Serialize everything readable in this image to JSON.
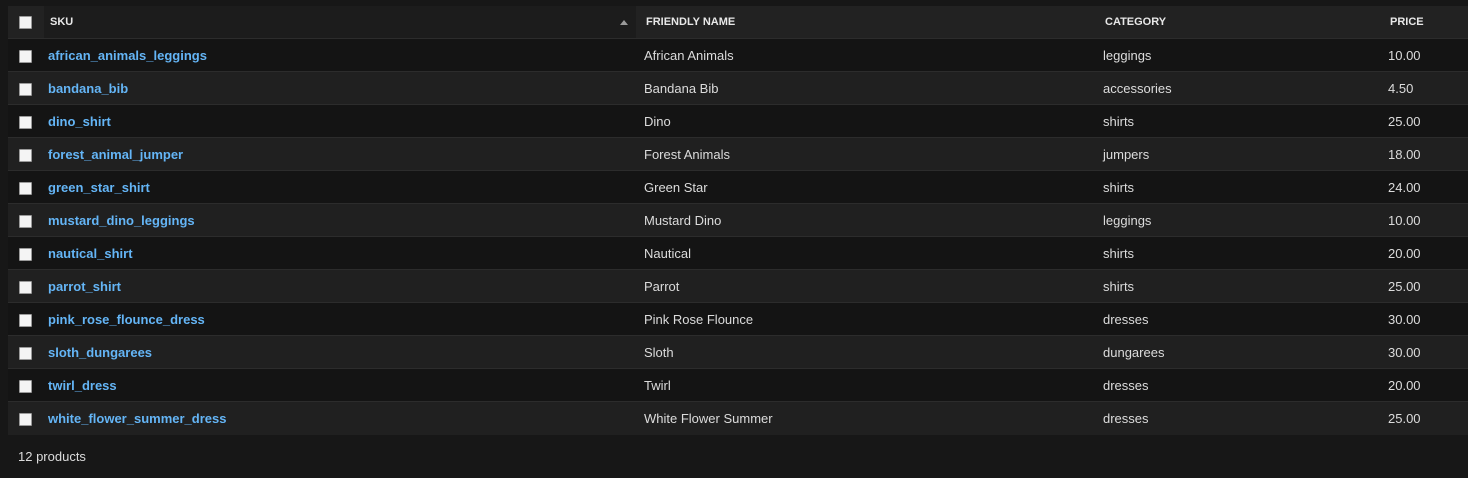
{
  "table": {
    "headers": {
      "sku": "SKU",
      "friendly_name": "FRIENDLY NAME",
      "category": "CATEGORY",
      "price": "PRICE"
    },
    "rows": [
      {
        "sku": "african_animals_leggings",
        "name": "African Animals",
        "category": "leggings",
        "price": "10.00"
      },
      {
        "sku": "bandana_bib",
        "name": "Bandana Bib",
        "category": "accessories",
        "price": "4.50"
      },
      {
        "sku": "dino_shirt",
        "name": "Dino",
        "category": "shirts",
        "price": "25.00"
      },
      {
        "sku": "forest_animal_jumper",
        "name": "Forest Animals",
        "category": "jumpers",
        "price": "18.00"
      },
      {
        "sku": "green_star_shirt",
        "name": "Green Star",
        "category": "shirts",
        "price": "24.00"
      },
      {
        "sku": "mustard_dino_leggings",
        "name": "Mustard Dino",
        "category": "leggings",
        "price": "10.00"
      },
      {
        "sku": "nautical_shirt",
        "name": "Nautical",
        "category": "shirts",
        "price": "20.00"
      },
      {
        "sku": "parrot_shirt",
        "name": "Parrot",
        "category": "shirts",
        "price": "25.00"
      },
      {
        "sku": "pink_rose_flounce_dress",
        "name": "Pink Rose Flounce",
        "category": "dresses",
        "price": "30.00"
      },
      {
        "sku": "sloth_dungarees",
        "name": "Sloth",
        "category": "dungarees",
        "price": "30.00"
      },
      {
        "sku": "twirl_dress",
        "name": "Twirl",
        "category": "dresses",
        "price": "20.00"
      },
      {
        "sku": "white_flower_summer_dress",
        "name": "White Flower Summer",
        "category": "dresses",
        "price": "25.00"
      }
    ]
  },
  "footer": {
    "count_text": "12 products"
  },
  "icons": {
    "sort": "sort-ascending-icon",
    "checkbox": "checkbox-icon"
  },
  "colors": {
    "link": "#64b5f6",
    "background": "#171717",
    "header": "#222222"
  }
}
